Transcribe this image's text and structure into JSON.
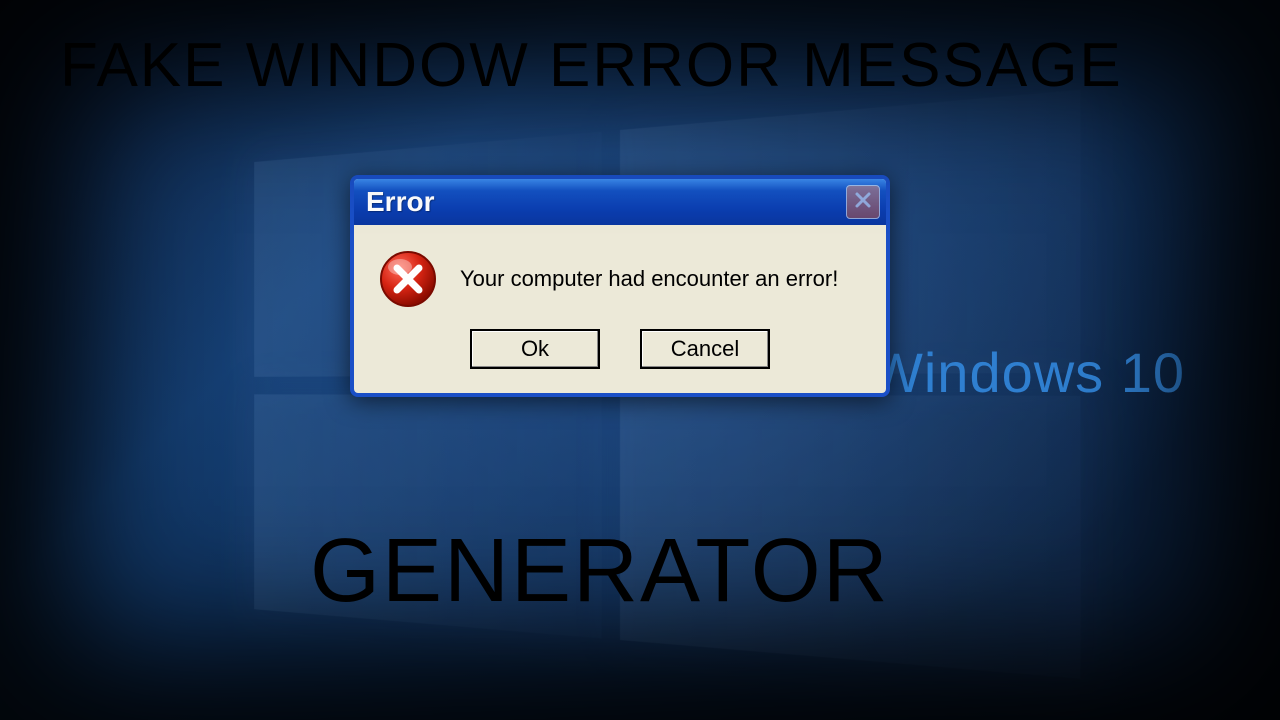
{
  "headings": {
    "top": "FAKE WINDOW ERROR MESSAGE",
    "bottom": "GENERATOR"
  },
  "background": {
    "brand_text": "Windows 10"
  },
  "dialog": {
    "title": "Error",
    "message": "Your computer had encounter an error!",
    "buttons": {
      "ok": "Ok",
      "cancel": "Cancel"
    },
    "icon": "error-x-icon",
    "close_icon": "close-icon"
  },
  "colors": {
    "titlebar_blue": "#1453c6",
    "dialog_face": "#ece9d8",
    "brand_blue": "#2f7fd0"
  }
}
